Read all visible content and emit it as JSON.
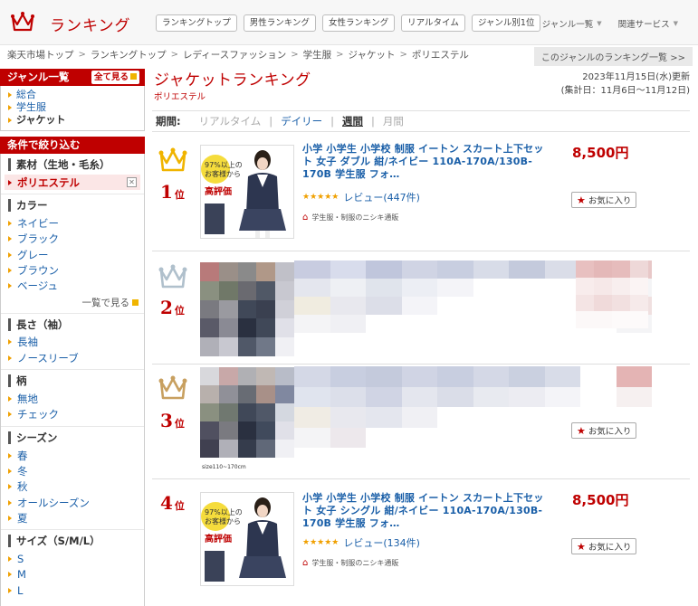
{
  "header": {
    "logo_text": "ランキング",
    "nav_buttons": [
      "ランキングトップ",
      "男性ランキング",
      "女性ランキング",
      "リアルタイム",
      "ジャンル別1位"
    ],
    "top_links": [
      "ジャンル一覧",
      "関連サービス"
    ]
  },
  "breadcrumb": [
    "楽天市場トップ",
    "ランキングトップ",
    "レディースファッション",
    "学生服",
    "ジャケット",
    "ポリエステル"
  ],
  "genre_list_link": "このジャンルのランキング一覧 >>",
  "sidebar": {
    "genre_title": "ジャンル一覧",
    "see_all": "全て見る",
    "genre_items": [
      "総合",
      "学生服",
      "ジャケット"
    ],
    "filter_title": "条件で絞り込む",
    "material_title": "素材（生地・毛糸）",
    "material_selected": "ポリエステル",
    "color_title": "カラー",
    "colors": [
      "ネイビー",
      "ブラック",
      "グレー",
      "ブラウン",
      "ベージュ"
    ],
    "more_label": "一覧で見る",
    "sleeve_title": "長さ（袖）",
    "sleeves": [
      "長袖",
      "ノースリーブ"
    ],
    "pattern_title": "柄",
    "patterns": [
      "無地",
      "チェック"
    ],
    "season_title": "シーズン",
    "seasons": [
      "春",
      "冬",
      "秋",
      "オールシーズン",
      "夏"
    ],
    "size_title": "サイズ（S/M/L）",
    "sizes": [
      "S",
      "M",
      "L"
    ]
  },
  "main": {
    "title": "ジャケットランキング",
    "subtitle": "ポリエステル",
    "updated": "2023年11月15日(水)更新",
    "period_range": "(集計日：11月6日〜11月12日)",
    "period_label": "期間:",
    "periods": [
      "リアルタイム",
      "デイリー",
      "週間",
      "月間"
    ],
    "items": [
      {
        "rank": "1",
        "rank_suffix": "位",
        "title": "小学 小学生 小学校 制服 イートン スカート上下セット 女子 ダブル 紺/ネイビー 110A-170A/130B-170B 学生服 フォ…",
        "price": "8,500円",
        "stars": "★★★★★",
        "reviews": "レビュー(447件)",
        "shop": "学生服・制服のニシキ通販",
        "fav": "お気に入り",
        "badge_top": "97%以上の",
        "badge_mid": "お客様から",
        "badge_bottom": "高評価"
      },
      {
        "rank": "2",
        "rank_suffix": "位",
        "title": "",
        "price": "",
        "fav": ""
      },
      {
        "rank": "3",
        "rank_suffix": "位",
        "title": "",
        "price": "",
        "fav": "お気に入り",
        "size_note": "size110~170cm"
      },
      {
        "rank": "4",
        "rank_suffix": "位",
        "title": "小学 小学生 小学校 制服 イートン スカート上下セット 女子 シングル 紺/ネイビー 110A-170A/130B-170B 学生服 フォ…",
        "price": "8,500円",
        "stars": "★★★★★",
        "reviews": "レビュー(134件)",
        "shop": "学生服・制服のニシキ通販",
        "fav": "お気に入り",
        "badge_top": "97%以上の",
        "badge_mid": "お客様から",
        "badge_bottom": "高評価"
      }
    ]
  },
  "colors": {
    "accent": "#bf0000",
    "link": "#1a5fa8",
    "gold": "#f0b400",
    "silver": "#b0c0cc",
    "bronze": "#c8a060"
  }
}
